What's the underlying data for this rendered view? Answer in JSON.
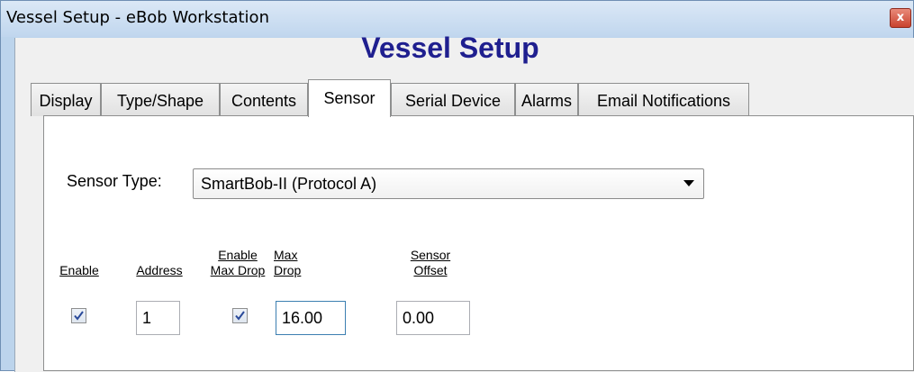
{
  "window": {
    "title": "Vessel Setup - eBob Workstation",
    "close_glyph": "x"
  },
  "heading": "Vessel Setup",
  "tabs": [
    {
      "label": "Display"
    },
    {
      "label": "Type/Shape"
    },
    {
      "label": "Contents"
    },
    {
      "label": "Sensor",
      "active": true
    },
    {
      "label": "Serial Device"
    },
    {
      "label": "Alarms"
    },
    {
      "label": "Email Notifications"
    }
  ],
  "sensor": {
    "type_label": "Sensor Type:",
    "type_value": "SmartBob-II (Protocol A)",
    "columns": {
      "enable": "Enable",
      "address": "Address",
      "enable_max_drop_line1": "Enable",
      "enable_max_drop_line2": "Max Drop",
      "max_drop_line1": "Max",
      "max_drop_line2": "Drop",
      "sensor_offset_line1": "Sensor",
      "sensor_offset_line2": "Offset"
    },
    "row": {
      "enable": true,
      "address": "1",
      "enable_max_drop": true,
      "max_drop": "16.00",
      "sensor_offset": "0.00"
    }
  },
  "colors": {
    "heading": "#1f1f8f",
    "titlebar": "#c8dcf2",
    "panel": "#ffffff"
  },
  "icons": {
    "close": "close-icon",
    "dropdown": "chevron-down-icon",
    "check": "check-icon"
  }
}
